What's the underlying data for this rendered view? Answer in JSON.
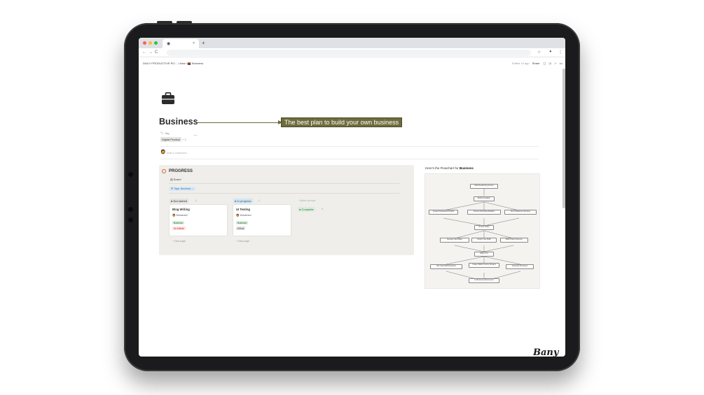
{
  "browser": {
    "tab_icon": "notion-icon",
    "tab_close": "×",
    "new_tab": "+",
    "nav_back": "←",
    "nav_forward": "→",
    "nav_reload": "C"
  },
  "notion_topbar": {
    "breadcrumb": "DAILY PRODUCTIVE RO... / Area / 💼 Business",
    "edited": "Edited 1h ago",
    "share": "Share"
  },
  "page": {
    "title": "Business",
    "annotation": "The best plan to build your own business",
    "tag_label": "Tag",
    "tag_value": "Digital Product",
    "tag_more": "+ 2",
    "comment_placeholder": "Add a comment..."
  },
  "progress": {
    "title": "PROGRESS",
    "view": "Board",
    "filter": "Tags: Business",
    "columns": [
      {
        "label": "Not started",
        "count": "1",
        "color": "#e3e2e0"
      },
      {
        "label": "In progress",
        "count": "1",
        "color": "#d3e5ef"
      }
    ],
    "hidden_groups": "Hidden groups",
    "complete": {
      "label": "Complete",
      "count": "0"
    },
    "cards": [
      {
        "title": "Blog Writing",
        "user": "Mohamed",
        "tags": [
          "Business",
          "Un-Initiate"
        ]
      },
      {
        "title": "UI Testing",
        "user": "Mohamed",
        "tags": [
          "Business",
          "UI/tool"
        ]
      }
    ],
    "new_page": "+ New page"
  },
  "flowchart": {
    "caption_prefix": "Here's the Flowchart for",
    "caption_bold": "Business",
    "nodes": [
      "Start Freelancing Journey",
      "Build Foundation",
      "Create Professional Portfolio",
      "Choose Niche/Specialization",
      "Set Up Business Structure",
      "Growth Phase",
      "Develop Client Base",
      "Perfect Your Skills",
      "Build Online Presence",
      "Scale to 6+",
      "Hire Team/Subcontractors",
      "Create Holistic Income Streams",
      "Automate Processes",
      "6+ Business Achievement"
    ]
  },
  "signature": "Bany"
}
